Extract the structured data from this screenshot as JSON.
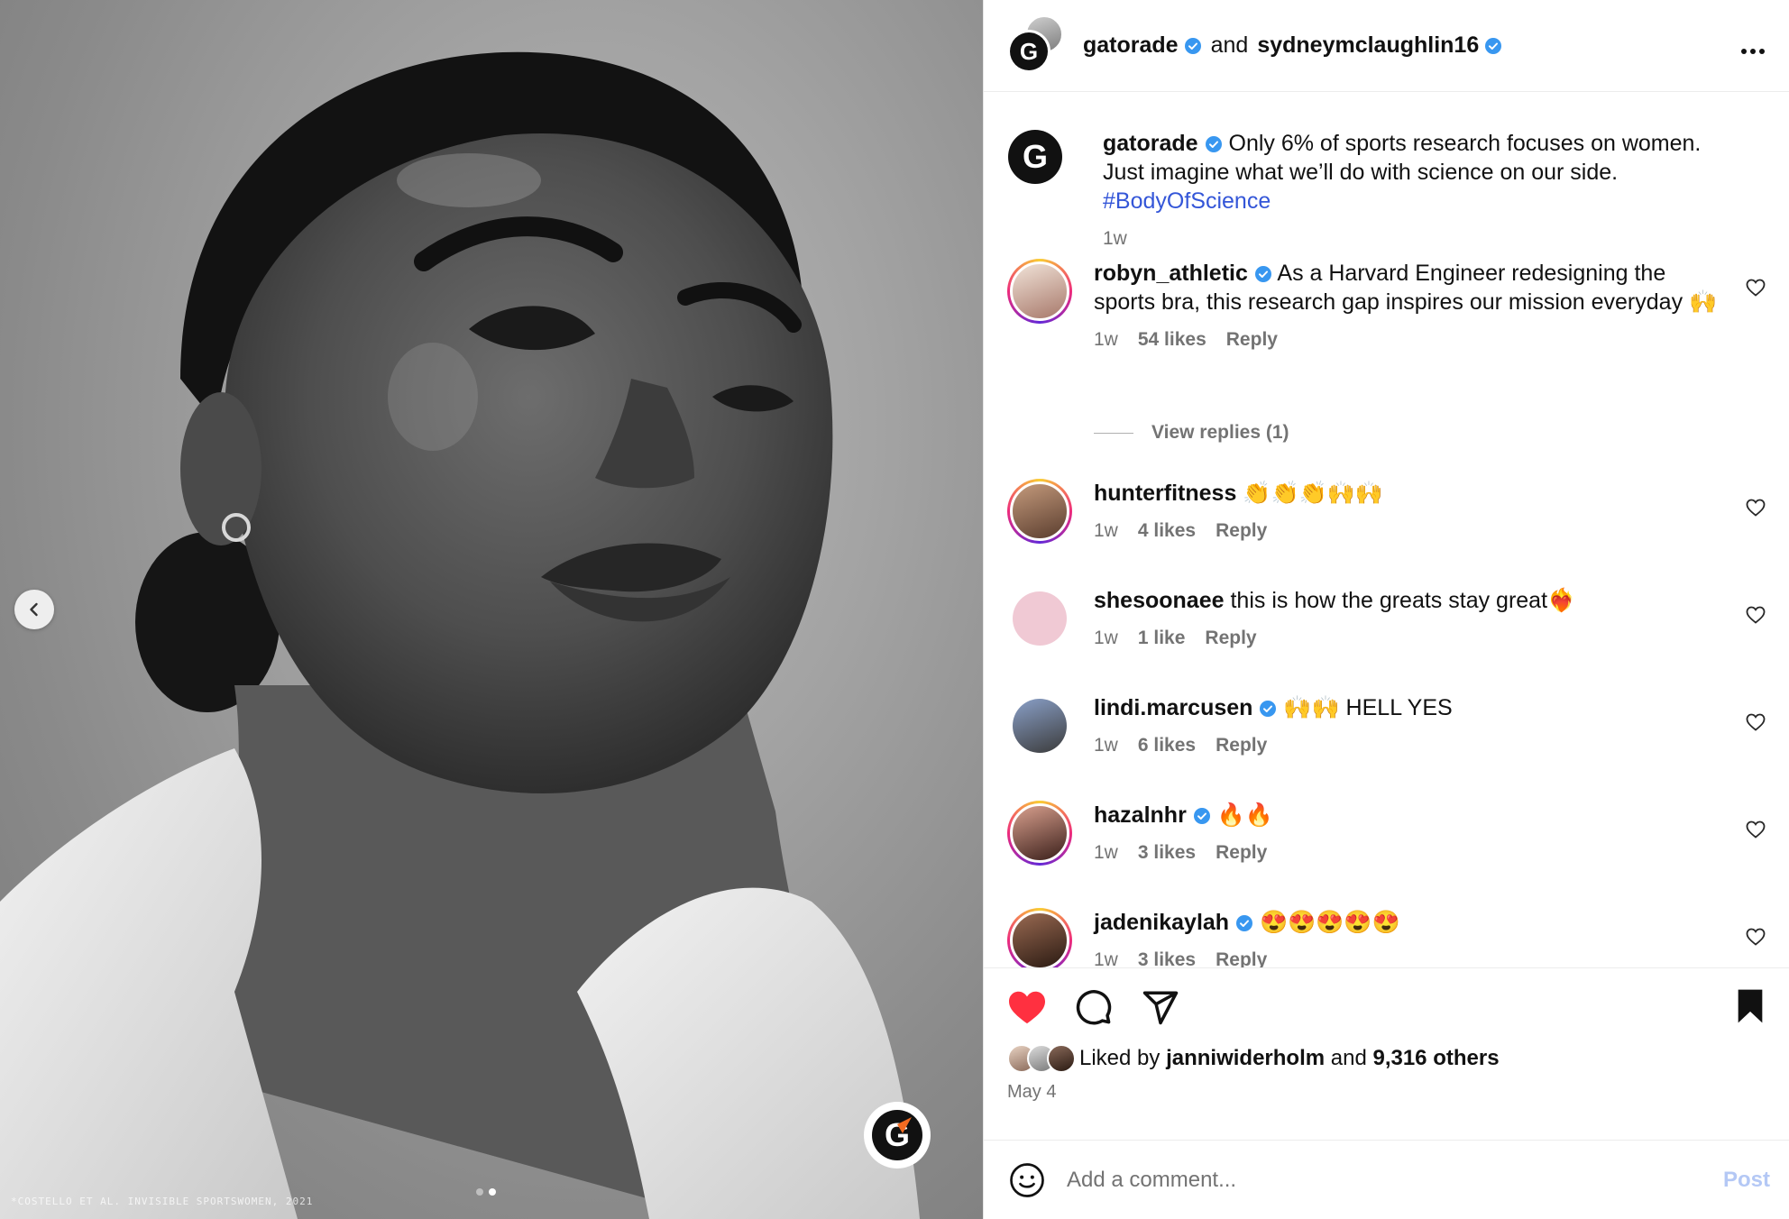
{
  "photo": {
    "caption": "*COSTELLO ET AL. INVISIBLE SPORTSWOMEN, 2021",
    "logo_letter": "G",
    "prev_icon": "chevron-left-icon"
  },
  "header": {
    "user1": "gatorade",
    "and_text": "and",
    "user2": "sydneymclaughlin16",
    "more_icon": "more-horizontal-icon"
  },
  "caption": {
    "username": "gatorade",
    "text": "Only 6% of sports research focuses on women. Just imagine what we’ll do with science on our side.",
    "hashtag": "#BodyOfScience",
    "time": "1w"
  },
  "comments": [
    {
      "username": "robyn_athletic",
      "verified": true,
      "text": "As a Harvard Engineer redesigning the sports bra, this research gap inspires our mission everyday 🙌",
      "time": "1w",
      "likes": "54 likes",
      "reply": "Reply"
    },
    {
      "username": "hunterfitness",
      "verified": false,
      "text": "👏👏👏🙌🙌",
      "time": "1w",
      "likes": "4 likes",
      "reply": "Reply"
    },
    {
      "username": "shesoonaee",
      "verified": false,
      "text": "this is how the greats stay great❤️‍🔥",
      "time": "1w",
      "likes": "1 like",
      "reply": "Reply"
    },
    {
      "username": "lindi.marcusen",
      "verified": true,
      "text": "🙌🙌 HELL YES",
      "time": "1w",
      "likes": "6 likes",
      "reply": "Reply"
    },
    {
      "username": "hazalnhr",
      "verified": true,
      "text": "🔥🔥",
      "time": "1w",
      "likes": "3 likes",
      "reply": "Reply"
    },
    {
      "username": "jadenikaylah",
      "verified": true,
      "text": "😍😍😍😍😍",
      "time": "1w",
      "likes": "3 likes",
      "reply": "Reply"
    }
  ],
  "view_replies": "View replies (1)",
  "actions": {
    "liked_by_prefix": "Liked by",
    "liked_by_user": "janniwiderholm",
    "liked_by_and": "and",
    "liked_by_others": "9,316 others",
    "date": "May 4"
  },
  "comment_box": {
    "placeholder": "Add a comment...",
    "post_label": "Post"
  },
  "colors": {
    "verified": "#3897f0",
    "hashtag": "#3456d8",
    "heart_liked": "#ff3040",
    "post_disabled": "#b4c8f5"
  }
}
